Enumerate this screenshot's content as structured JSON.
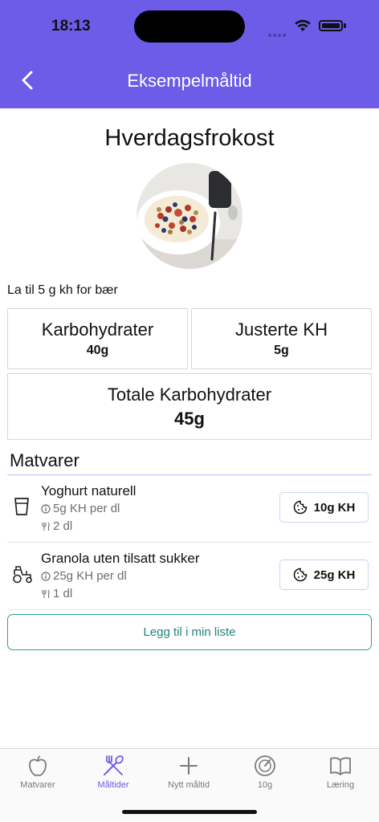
{
  "status": {
    "time": "18:13"
  },
  "nav": {
    "title": "Eksempelmåltid"
  },
  "meal": {
    "title": "Hverdagsfrokost",
    "note": "La til 5 g kh for bær"
  },
  "summary": {
    "carbs_label": "Karbohydrater",
    "carbs_value": "40g",
    "adjusted_label": "Justerte KH",
    "adjusted_value": "5g",
    "total_label": "Totale Karbohydrater",
    "total_value": "45g"
  },
  "foods": {
    "section_title": "Matvarer",
    "items": [
      {
        "name": "Yoghurt naturell",
        "carb_rate": "5g KH per dl",
        "amount": "2 dl",
        "carbs": "10g KH",
        "icon": "glass-icon"
      },
      {
        "name": "Granola uten tilsatt sukker",
        "carb_rate": "25g KH per dl",
        "amount": "1 dl",
        "carbs": "25g KH",
        "icon": "tractor-icon"
      }
    ]
  },
  "actions": {
    "add_to_list": "Legg til i min liste"
  },
  "tabs": [
    {
      "label": "Matvarer",
      "icon": "apple-icon"
    },
    {
      "label": "Måltider",
      "icon": "utensils-icon",
      "active": true
    },
    {
      "label": "Nytt måltid",
      "icon": "plus-icon"
    },
    {
      "label": "10g",
      "icon": "gauge-icon"
    },
    {
      "label": "Læring",
      "icon": "book-icon"
    }
  ],
  "colors": {
    "primary": "#6c5ce7",
    "teal": "#2f9d8f",
    "muted": "#6d6d6d"
  }
}
